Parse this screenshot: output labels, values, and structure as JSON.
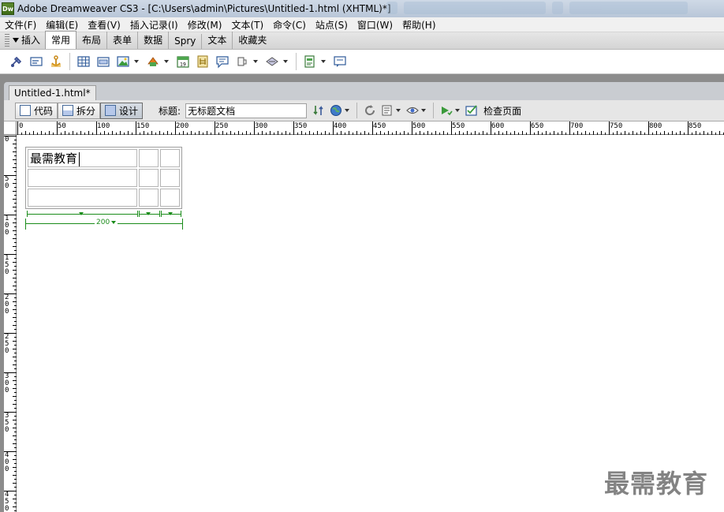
{
  "window": {
    "logo_text": "Dw",
    "title": "Adobe Dreamweaver CS3 - [C:\\Users\\admin\\Pictures\\Untitled-1.html (XHTML)*]"
  },
  "menu": [
    "文件(F)",
    "编辑(E)",
    "查看(V)",
    "插入记录(I)",
    "修改(M)",
    "文本(T)",
    "命令(C)",
    "站点(S)",
    "窗口(W)",
    "帮助(H)"
  ],
  "insert_panel": {
    "title": "插入",
    "tabs": [
      "常用",
      "布局",
      "表单",
      "数据",
      "Spry",
      "文本",
      "收藏夹"
    ],
    "active_tab": "常用"
  },
  "document_tab": {
    "name": "Untitled-1.html*"
  },
  "doc_toolbar": {
    "code_label": "代码",
    "split_label": "拆分",
    "design_label": "设计",
    "active_view": "设计",
    "title_label": "标题:",
    "title_value": "无标题文档",
    "check_page_label": "检查页面"
  },
  "ruler": {
    "h_labels": [
      "0",
      "50",
      "100",
      "150",
      "200",
      "250",
      "300",
      "350",
      "400",
      "450",
      "500",
      "550",
      "600",
      "650",
      "700",
      "750",
      "800",
      "850"
    ],
    "v_labels": [
      "0",
      "50",
      "100",
      "150",
      "200",
      "250",
      "300",
      "350",
      "400",
      "450"
    ]
  },
  "table": {
    "rows": [
      [
        "最需教育",
        "",
        ""
      ],
      [
        "",
        "",
        ""
      ],
      [
        "",
        "",
        ""
      ]
    ],
    "total_width_label": "200"
  },
  "watermark": "最需教育",
  "colors": {
    "table_width_guide": "#1a8c1a",
    "titlebar": "#c5d2e1"
  }
}
